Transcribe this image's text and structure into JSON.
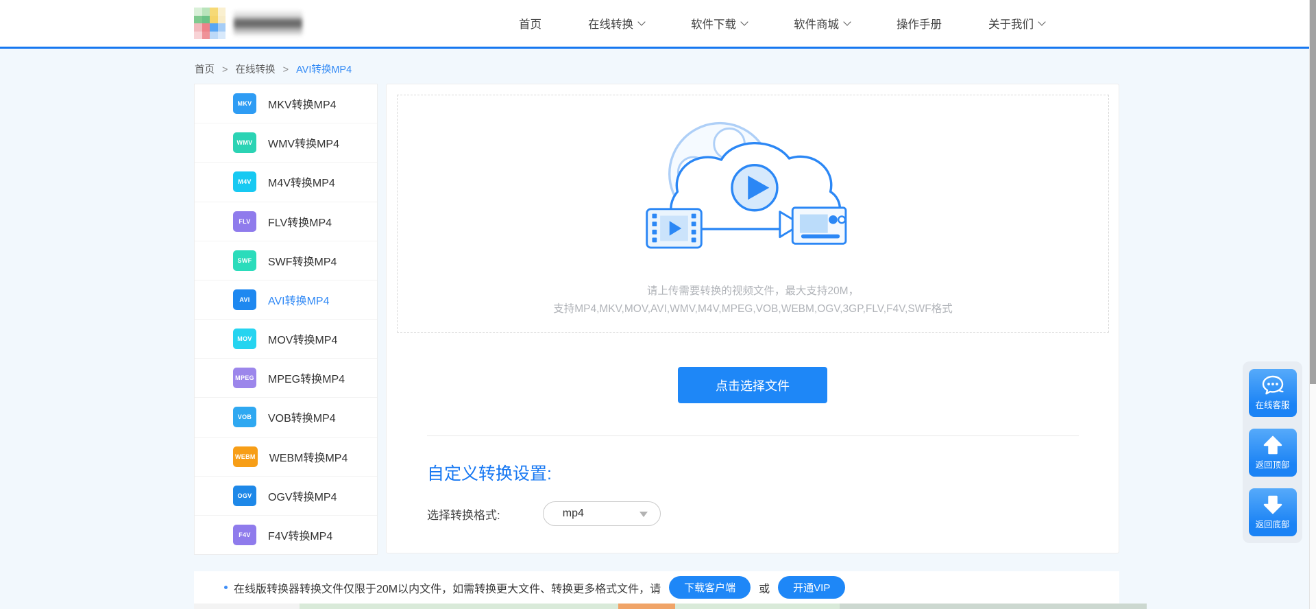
{
  "header": {
    "nav_items": [
      {
        "label": "首页",
        "has_chevron": false
      },
      {
        "label": "在线转换",
        "has_chevron": true
      },
      {
        "label": "软件下载",
        "has_chevron": true
      },
      {
        "label": "软件商城",
        "has_chevron": true
      },
      {
        "label": "操作手册",
        "has_chevron": false
      },
      {
        "label": "关于我们",
        "has_chevron": true
      }
    ],
    "accent_color": "#1677F0",
    "logo_mosaic_colors": [
      "#d9f0d8",
      "#b9e4bb",
      "#f6d976",
      "#faf0d0",
      "#7fca8f",
      "#6cc287",
      "#f5d46a",
      "#f8ecc8",
      "#f2b9bd",
      "#ee8289",
      "#58a6f5",
      "#a6cdf6",
      "#f8d3d6",
      "#ef9298",
      "#bcd9f8",
      "#d8e9fb"
    ]
  },
  "breadcrumb": {
    "separator": ">",
    "items": [
      "首页",
      "在线转换",
      "AVI转换MP4"
    ],
    "current_color": "#2F88F5"
  },
  "sidebar": {
    "items": [
      {
        "badge": "MKV",
        "label": "MKV转换MP4",
        "color": "#2E9CF4",
        "active": false
      },
      {
        "badge": "WMV",
        "label": "WMV转换MP4",
        "color": "#2BD3B4",
        "active": false
      },
      {
        "badge": "M4V",
        "label": "M4V转换MP4",
        "color": "#17C9F2",
        "active": false
      },
      {
        "badge": "FLV",
        "label": "FLV转换MP4",
        "color": "#8F7BEC",
        "active": false
      },
      {
        "badge": "SWF",
        "label": "SWF转换MP4",
        "color": "#2BDCBB",
        "active": false
      },
      {
        "badge": "AVI",
        "label": "AVI转换MP4",
        "color": "#1E88F0",
        "active": true
      },
      {
        "badge": "MOV",
        "label": "MOV转换MP4",
        "color": "#26D4F0",
        "active": false
      },
      {
        "badge": "MPEG",
        "label": "MPEG转换MP4",
        "color": "#9C86EB",
        "active": false
      },
      {
        "badge": "VOB",
        "label": "VOB转换MP4",
        "color": "#2FA8F1",
        "active": false
      },
      {
        "badge": "WEBM",
        "label": "WEBM转换MP4",
        "color": "#F79E17",
        "active": false
      },
      {
        "badge": "OGV",
        "label": "OGV转换MP4",
        "color": "#1E88E8",
        "active": false
      },
      {
        "badge": "F4V",
        "label": "F4V转换MP4",
        "color": "#8F7BEC",
        "active": false
      }
    ]
  },
  "upload": {
    "hint_line1": "请上传需要转换的视频文件，最大支持20M，",
    "hint_line2": "支持MP4,MKV,MOV,AVI,WMV,M4V,MPEG,VOB,WEBM,OGV,3GP,FLV,F4V,SWF格式",
    "button_label": "点击选择文件",
    "button_color": "#1E87F7"
  },
  "settings": {
    "title": "自定义转换设置:",
    "format_label": "选择转换格式:",
    "format_value": "mp4"
  },
  "float_buttons": [
    {
      "label": "在线客服",
      "icon": "chat-icon"
    },
    {
      "label": "返回顶部",
      "icon": "arrow-up-icon"
    },
    {
      "label": "返回底部",
      "icon": "arrow-down-icon"
    }
  ],
  "notice": {
    "text": "在线版转换器转换文件仅限于20M以内文件，如需转换更大文件、转换更多格式文件，请",
    "download_label": "下载客户端",
    "or_text": "或",
    "vip_label": "开通VIP"
  }
}
